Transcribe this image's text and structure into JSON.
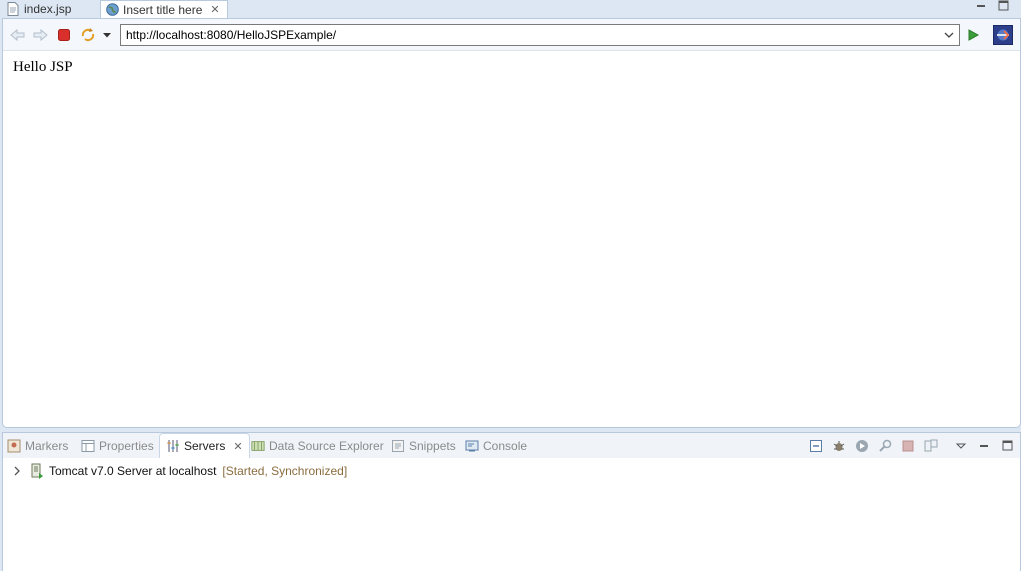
{
  "editor_tabs": [
    {
      "label": "index.jsp",
      "icon": "jsp-file-icon",
      "active": false
    },
    {
      "label": "Insert title here",
      "icon": "globe-icon",
      "active": true
    }
  ],
  "browser": {
    "url": "http://localhost:8080/HelloJSPExample/",
    "page_text": "Hello JSP"
  },
  "views": {
    "tabs": [
      {
        "label": "Markers",
        "icon": "markers-icon"
      },
      {
        "label": "Properties",
        "icon": "properties-icon"
      },
      {
        "label": "Servers",
        "icon": "servers-icon"
      },
      {
        "label": "Data Source Explorer",
        "icon": "data-source-icon"
      },
      {
        "label": "Snippets",
        "icon": "snippets-icon"
      },
      {
        "label": "Console",
        "icon": "console-icon"
      }
    ],
    "active_tab": "Servers",
    "server": {
      "name": "Tomcat v7.0 Server at localhost",
      "status": "[Started, Synchronized]"
    }
  },
  "colors": {
    "frame": "#dce7f3",
    "border": "#b8c9dd",
    "status_text": "#8b6d3f",
    "run_green": "#3a9d3a",
    "stop_red": "#d9302c"
  }
}
